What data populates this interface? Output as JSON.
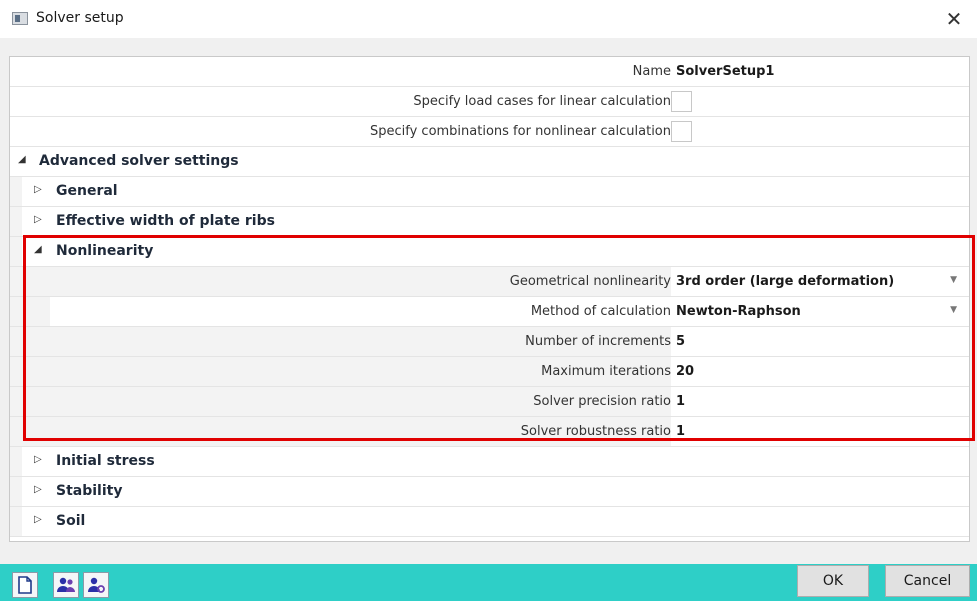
{
  "window": {
    "title": "Solver setup",
    "close": "✕"
  },
  "top_rows": [
    {
      "label": "Name",
      "value": "SolverSetup1"
    },
    {
      "label": "Specify load cases for linear calculation",
      "checked": false
    },
    {
      "label": "Specify combinations for nonlinear calculation",
      "checked": false
    }
  ],
  "sections": {
    "advanced": "Advanced solver settings",
    "general": "General",
    "effective_width": "Effective width of plate ribs",
    "nonlinearity": "Nonlinearity",
    "initial_stress": "Initial stress",
    "stability": "Stability",
    "soil": "Soil"
  },
  "nonlinearity_props": [
    {
      "label": "Geometrical nonlinearity",
      "value": "3rd order (large deformation)",
      "dropdown": true
    },
    {
      "label": "Method of calculation",
      "value": "Newton-Raphson",
      "dropdown": true
    },
    {
      "label": "Number of increments",
      "value": "5"
    },
    {
      "label": "Maximum iterations",
      "value": "20"
    },
    {
      "label": "Solver precision ratio",
      "value": "1"
    },
    {
      "label": "Solver robustness ratio",
      "value": "1"
    }
  ],
  "buttons": {
    "ok": "OK",
    "cancel": "Cancel"
  },
  "colors": {
    "highlight": "#e00000",
    "bottom_bar": "#2ecfc7"
  }
}
